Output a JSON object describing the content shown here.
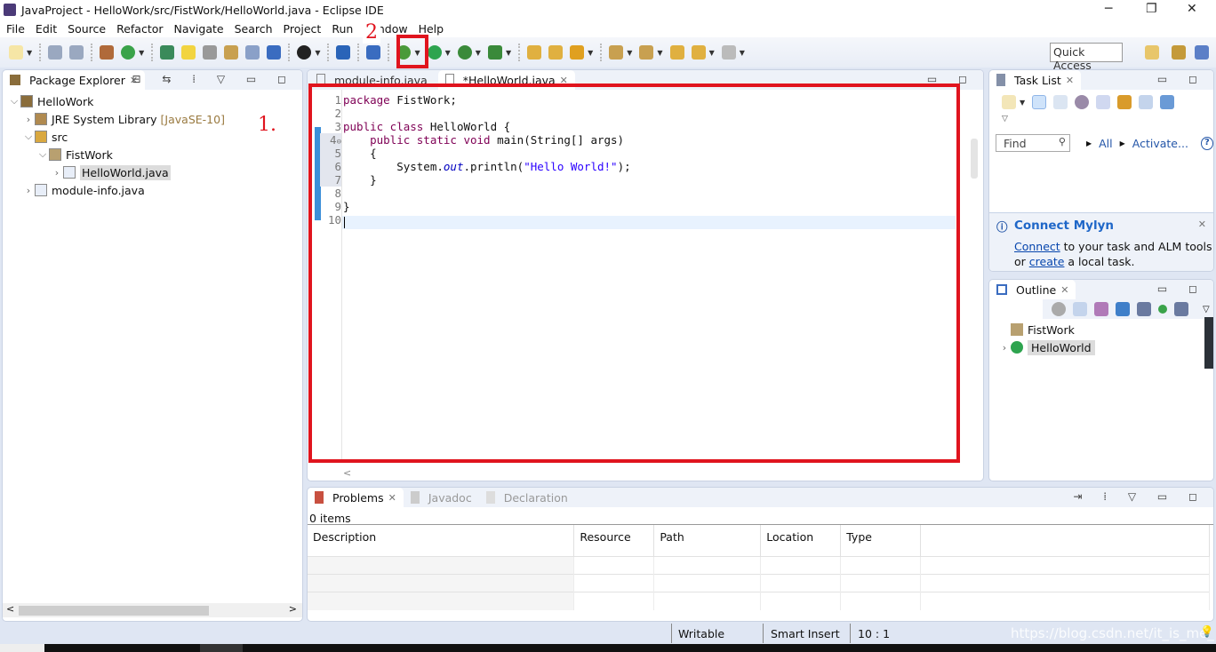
{
  "window": {
    "title": "JavaProject - HelloWork/src/FistWork/HelloWorld.java - Eclipse IDE"
  },
  "menu": [
    "File",
    "Edit",
    "Source",
    "Refactor",
    "Navigate",
    "Search",
    "Project",
    "Run",
    "Window",
    "Help"
  ],
  "toolbar": {
    "quick_access": "Quick Access"
  },
  "annotations": {
    "one": "1.",
    "two": "2",
    "color": "#e0141e"
  },
  "package_explorer": {
    "title": "Package Explorer",
    "tree": [
      {
        "label": "HelloWork",
        "depth": 0,
        "expanded": true,
        "icon": "project-icon"
      },
      {
        "label": "JRE System Library",
        "suffix": "[JavaSE-10]",
        "depth": 1,
        "expanded": false,
        "icon": "library-icon"
      },
      {
        "label": "src",
        "depth": 1,
        "expanded": true,
        "icon": "source-folder-icon"
      },
      {
        "label": "FistWork",
        "depth": 2,
        "expanded": true,
        "icon": "package-icon"
      },
      {
        "label": "HelloWorld.java",
        "depth": 3,
        "expanded": false,
        "icon": "java-file-icon",
        "selected": true
      },
      {
        "label": "module-info.java",
        "depth": 1,
        "expanded": false,
        "icon": "java-file-icon"
      }
    ]
  },
  "editor": {
    "tabs": [
      {
        "label": "module-info.java",
        "active": false
      },
      {
        "label": "*HelloWorld.java",
        "active": true
      }
    ],
    "lines": [
      [
        {
          "t": "package ",
          "c": "kw"
        },
        {
          "t": "FistWork;"
        }
      ],
      [],
      [
        {
          "t": "public class ",
          "c": "kw"
        },
        {
          "t": "HelloWorld {"
        }
      ],
      [
        {
          "t": "    public static void ",
          "c": "kw"
        },
        {
          "t": "main(String[] args)"
        }
      ],
      [
        {
          "t": "    {"
        }
      ],
      [
        {
          "t": "        System."
        },
        {
          "t": "out",
          "c": "fld"
        },
        {
          "t": ".println("
        },
        {
          "t": "\"Hello World!\"",
          "c": "str"
        },
        {
          "t": ");"
        }
      ],
      [
        {
          "t": "    }"
        }
      ],
      [],
      [
        {
          "t": "}"
        }
      ],
      []
    ],
    "cursor": "10 : 1"
  },
  "task_list": {
    "title": "Task List",
    "find_placeholder": "Find",
    "all": "All",
    "activate": "Activate...",
    "mylyn": {
      "title": "Connect Mylyn",
      "connect": "Connect",
      "text1": " to your task and ALM tools",
      "or": "or ",
      "create": "create",
      "text2": " a local task."
    }
  },
  "outline": {
    "title": "Outline",
    "items": [
      {
        "label": "FistWork",
        "icon": "package-icon"
      },
      {
        "label": "HelloWorld",
        "icon": "class-icon",
        "selected": true
      }
    ]
  },
  "problems": {
    "tabs": [
      "Problems",
      "Javadoc",
      "Declaration"
    ],
    "count": "0 items",
    "columns": [
      "Description",
      "Resource",
      "Path",
      "Location",
      "Type"
    ]
  },
  "status": {
    "writable": "Writable",
    "insert": "Smart Insert",
    "position": "10 : 1",
    "watermark": "https://blog.csdn.net/it_is_me_"
  }
}
